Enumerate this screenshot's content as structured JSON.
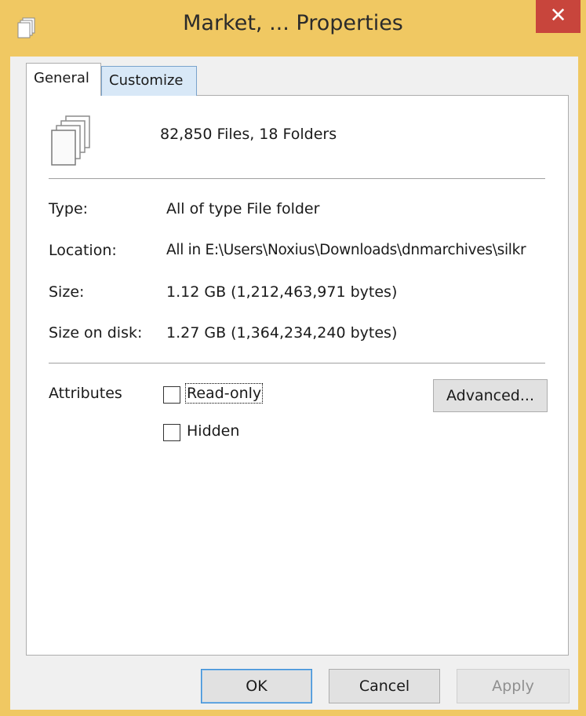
{
  "window": {
    "title": "Market, ... Properties",
    "close_glyph": "✕",
    "title_icon": "folder-properties-icon",
    "frame_color": "#f0c862",
    "close_color": "#c8453c"
  },
  "tabs": [
    {
      "label": "General",
      "selected": true
    },
    {
      "label": "Customize",
      "selected": false
    }
  ],
  "general": {
    "files_icon": "multiple-files-icon",
    "summary": "82,850 Files, 18 Folders",
    "type_label": "Type:",
    "type_value": "All of type File folder",
    "location_label": "Location:",
    "location_value": "All in E:\\Users\\Noxius\\Downloads\\dnmarchives\\silkr",
    "size_label": "Size:",
    "size_value": "1.12 GB (1,212,463,971 bytes)",
    "size_on_disk_label": "Size on disk:",
    "size_on_disk_value": "1.27 GB (1,364,234,240 bytes)",
    "attributes_label": "Attributes",
    "readonly_label": "Read-only",
    "readonly_checked": false,
    "hidden_label": "Hidden",
    "hidden_checked": false,
    "advanced_label": "Advanced..."
  },
  "footer": {
    "ok_label": "OK",
    "cancel_label": "Cancel",
    "apply_label": "Apply"
  }
}
